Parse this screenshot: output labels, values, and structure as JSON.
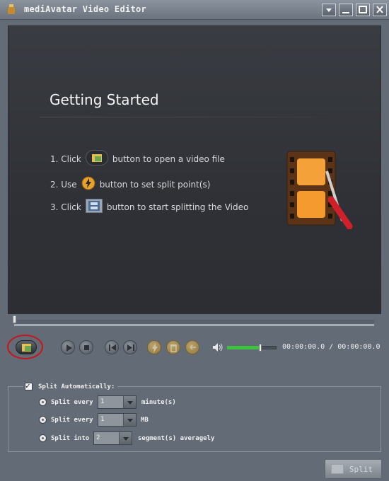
{
  "window": {
    "title": "mediAvatar Video Editor"
  },
  "getting_started": {
    "title": "Getting Started",
    "steps": [
      {
        "before": "1. Click",
        "after": "button to open a video file"
      },
      {
        "before": "2. Use",
        "after": "button to set split point(s)"
      },
      {
        "before": "3. Click",
        "after": "button to start splitting the Video"
      }
    ]
  },
  "playback": {
    "time_readout": "00:00:00.0 / 00:00:00.0",
    "volume_level": 0.67
  },
  "split": {
    "auto_label": "Split Automatically:",
    "options": [
      {
        "label": "Split every",
        "value": "1",
        "unit": "minute(s)"
      },
      {
        "label": "Split every",
        "value": "1",
        "unit": "MB"
      },
      {
        "label": "Split into",
        "value": "2",
        "unit": "segment(s) averagely"
      }
    ],
    "button_label": "Split"
  },
  "colors": {
    "accent_green": "#3bc43b",
    "highlight_red": "#c8141b",
    "preview_bg": "#2f3136"
  }
}
